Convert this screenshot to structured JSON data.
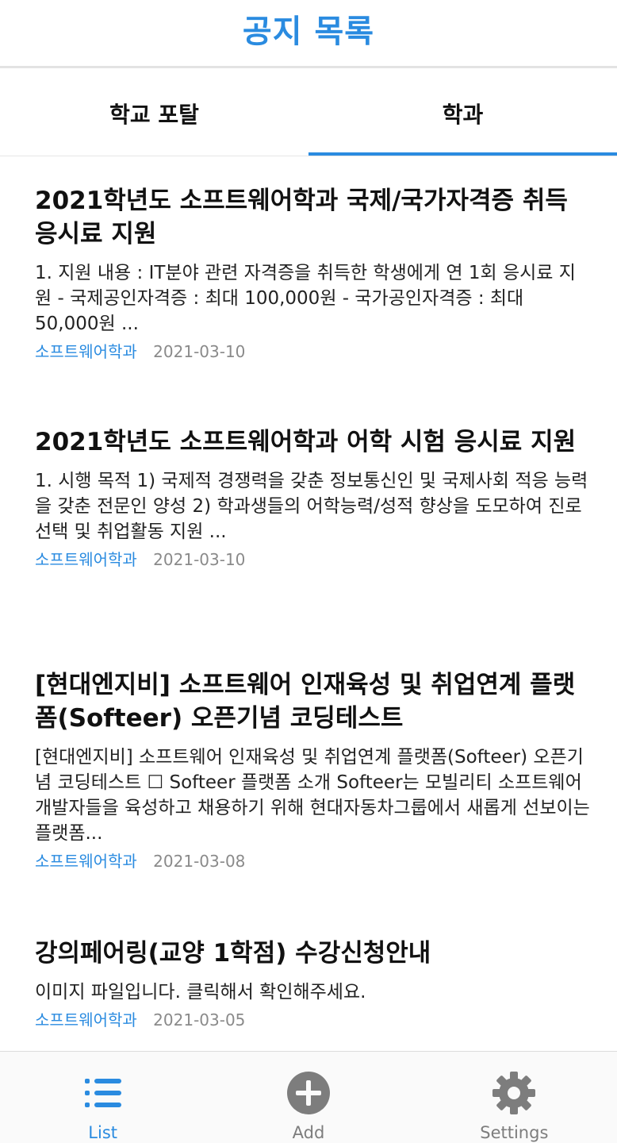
{
  "header": {
    "title": "공지 목록"
  },
  "tabs": [
    {
      "label": "학교 포탈",
      "active": false
    },
    {
      "label": "학과",
      "active": true
    }
  ],
  "notices": [
    {
      "title": "2021학년도 소프트웨어학과 국제/국가자격증 취득 응시료 지원",
      "body": "1. 지원 내용 : IT분야 관련 자격증을 취득한 학생에게 연 1회 응시료 지원 - 국제공인자격증 : 최대 100,000원 - 국가공인자격증 : 최대 50,000원 ...",
      "department": "소프트웨어학과",
      "date": "2021-03-10"
    },
    {
      "title": "2021학년도 소프트웨어학과 어학 시험 응시료 지원",
      "body": "1. 시행 목적  1) 국제적 경쟁력을 갖춘 정보통신인 및 국제사회 적응 능력을 갖춘 전문인 양성 2) 학과생들의 어학능력/성적 향상을 도모하여 진로선택 및 취업활동 지원 ...",
      "department": "소프트웨어학과",
      "date": "2021-03-10"
    },
    {
      "title": "[현대엔지비] 소프트웨어 인재육성 및 취업연계 플랫폼(Softeer) 오픈기념 코딩테스트",
      "body": " [현대엔지비] 소프트웨어 인재육성 및 취업연계 플랫폼(Softeer) 오픈기념 코딩테스트  ☐ Softeer 플랫폼 소개  Softeer는 모빌리티 소프트웨어 개발자들을 육성하고 채용하기 위해 현대자동차그룹에서 새롭게 선보이는 플랫폼...",
      "department": "소프트웨어학과",
      "date": "2021-03-08"
    },
    {
      "title": "강의페어링(교양 1학점) 수강신청안내",
      "body": "이미지 파일입니다. 클릭해서 확인해주세요.",
      "department": "소프트웨어학과",
      "date": "2021-03-05"
    }
  ],
  "bottom_nav": [
    {
      "label": "List",
      "icon": "list-icon",
      "active": true
    },
    {
      "label": "Add",
      "icon": "plus-circle-icon",
      "active": false
    },
    {
      "label": "Settings",
      "icon": "gear-icon",
      "active": false
    }
  ],
  "colors": {
    "accent": "#2a8be0",
    "inactive": "#7d7d7d",
    "date": "#8a8a8a"
  }
}
